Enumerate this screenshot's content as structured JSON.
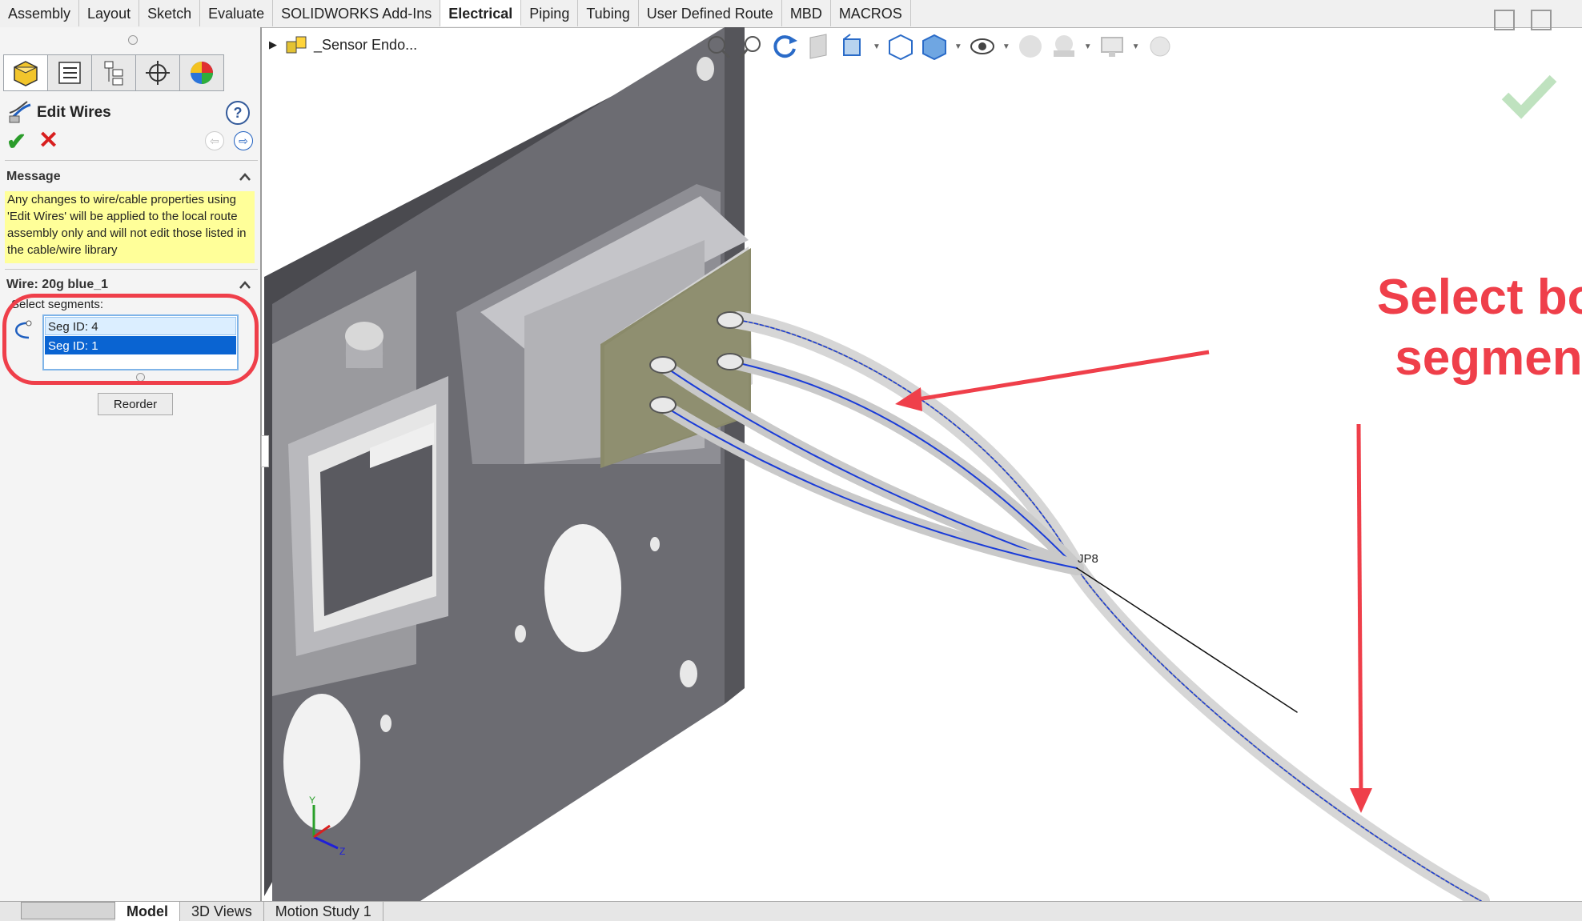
{
  "command_tabs": [
    "Assembly",
    "Layout",
    "Sketch",
    "Evaluate",
    "SOLIDWORKS Add-Ins",
    "Electrical",
    "Piping",
    "Tubing",
    "User Defined Route",
    "MBD",
    "MACROS"
  ],
  "active_command_tab": "Electrical",
  "property_manager": {
    "title": "Edit Wires",
    "help_symbol": "?",
    "ok_symbol": "✔",
    "cancel_symbol": "✕",
    "message_section": {
      "header": "Message",
      "text": "Any changes to wire/cable properties using 'Edit Wires' will be applied to the local route assembly only and will not edit those listed in the cable/wire library"
    },
    "wire_section": {
      "header": "Wire: 20g blue_1",
      "select_label": "Select segments:",
      "segments": [
        {
          "label": "Seg ID: 4",
          "selected": false
        },
        {
          "label": "Seg ID: 1",
          "selected": true
        }
      ],
      "reorder_label": "Reorder"
    }
  },
  "feature_tree": {
    "item_label": "_Sensor Endo..."
  },
  "viewport": {
    "junction_label": "JP8",
    "annotation": {
      "line1": "Select both",
      "line2": "segments",
      "color": "#ef3f4a"
    }
  },
  "bottom_tabs": [
    "Model",
    "3D Views",
    "Motion Study 1"
  ],
  "active_bottom_tab": "Model"
}
